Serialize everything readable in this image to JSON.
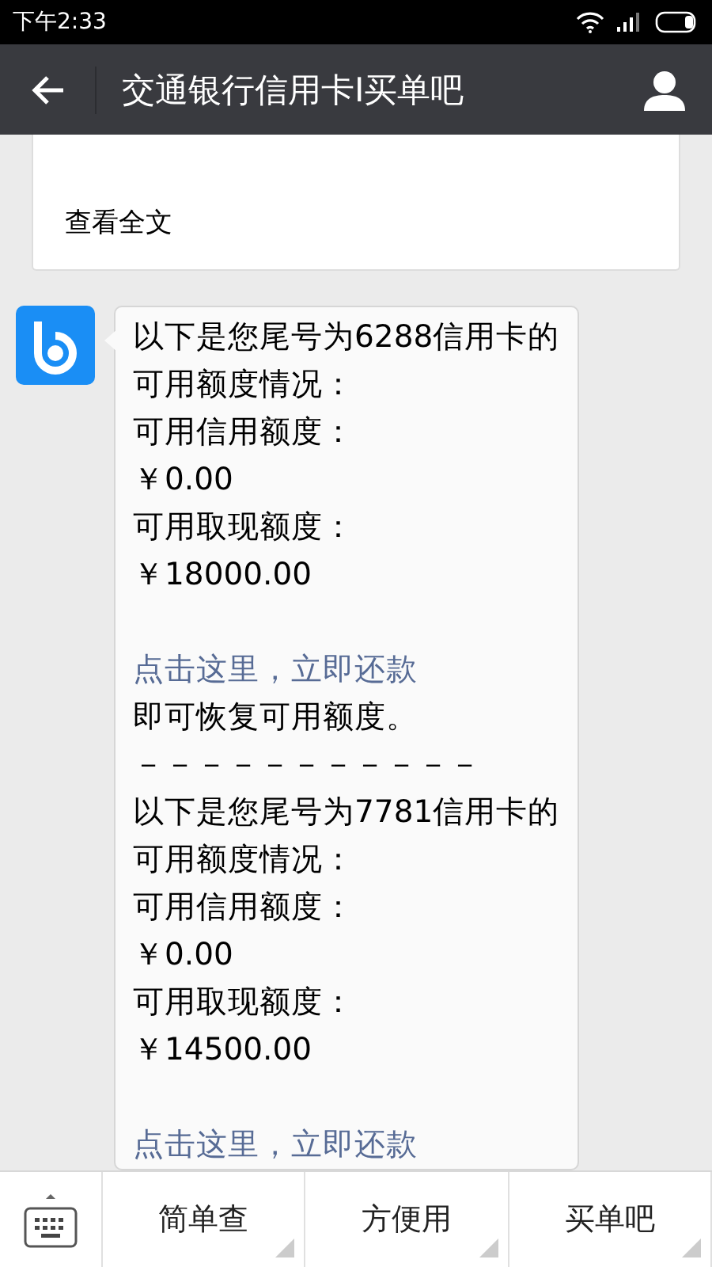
{
  "status_bar": {
    "time": "下午2:33"
  },
  "header": {
    "title": "交通银行信用卡I买单吧"
  },
  "article_card": {
    "link": "查看全文"
  },
  "message": {
    "lines": [
      {
        "kind": "text",
        "text": "以下是您尾号为6288信用卡的"
      },
      {
        "kind": "text",
        "text": "可用额度情况："
      },
      {
        "kind": "text",
        "text": "可用信用额度："
      },
      {
        "kind": "text",
        "text": "￥0.00"
      },
      {
        "kind": "text",
        "text": "可用取现额度："
      },
      {
        "kind": "text",
        "text": "￥18000.00"
      },
      {
        "kind": "gap"
      },
      {
        "kind": "link",
        "text": "点击这里，立即还款"
      },
      {
        "kind": "text",
        "text": "即可恢复可用额度。"
      },
      {
        "kind": "text",
        "text": "－－－－－－－－－－－"
      },
      {
        "kind": "text",
        "text": "以下是您尾号为7781信用卡的"
      },
      {
        "kind": "text",
        "text": "可用额度情况："
      },
      {
        "kind": "text",
        "text": "可用信用额度："
      },
      {
        "kind": "text",
        "text": "￥0.00"
      },
      {
        "kind": "text",
        "text": "可用取现额度："
      },
      {
        "kind": "text",
        "text": "￥14500.00"
      },
      {
        "kind": "gap"
      },
      {
        "kind": "link",
        "text": "点击这里，立即还款"
      }
    ]
  },
  "menu": [
    "简单查",
    "方便用",
    "买单吧"
  ]
}
